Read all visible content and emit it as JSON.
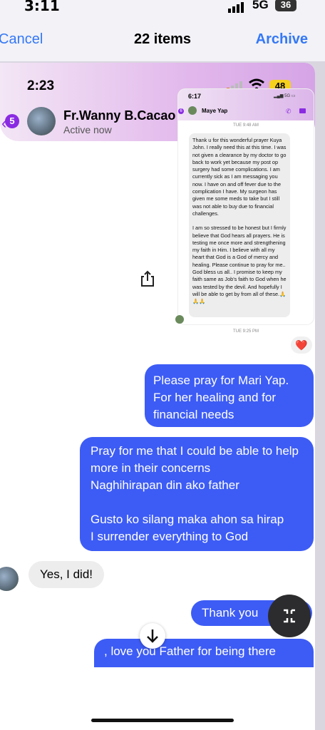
{
  "device_status": {
    "time": "3:11",
    "network": "5G",
    "battery": "36"
  },
  "nav": {
    "cancel": "Cancel",
    "title": "22 items",
    "archive": "Archive"
  },
  "screenshot": {
    "status": {
      "time": "2:23",
      "battery": "48"
    },
    "header": {
      "back_badge": "5",
      "contact_name": "Fr.Wanny B.Cacao",
      "presence": "Active now"
    },
    "embedded": {
      "time": "6:17",
      "network": "5G",
      "back_badge": "6",
      "contact_name": "Maye Yap",
      "timestamp_1": "TUE 9:48 AM",
      "message_p1": "Thank u for this wonderful prayer Kuya John. I really need this at this time. I was not given a clearance by my doctor to go back to work yet because my post op surgery had some complications. I am currently sick as I am messaging you now. I have on and off fever due to the complication I have. My surgeon has given me some meds to take but I still was not able to buy due to financial challenges.",
      "message_p2": "I am so stressed to be honest but I firmly believe that God hears all prayers. He is testing me once more and strengthening my faith in Him. I believe with all my heart that God is a God of mercy and healing. Please continue to pray for me.. God bless us all.. I promise to keep my faith same as Job's faith to God when he was tested by the devil. And hopefully I will be able to get by from all of these.🙏🙏🙏",
      "timestamp_2": "TUE 9:25 PM"
    },
    "reaction": "❤️",
    "messages": {
      "out_1": "Please pray for Mari Yap. For her healing and for financial needs",
      "out_2_line1": "Pray for me that I could be able to help more in their concerns",
      "out_2_line2": "Naghihirapan din ako father",
      "out_2_line3": "Gusto ko silang maka ahon sa hirap",
      "out_2_line4": "I surrender everything to God",
      "in_1": "Yes, I did!",
      "out_3": "Thank you",
      "out_4": ", love you Father for being there"
    }
  },
  "colors": {
    "accent": "#3478f6",
    "bubble_out": "#3d5cf5",
    "messenger_purple": "#8a2be2"
  }
}
